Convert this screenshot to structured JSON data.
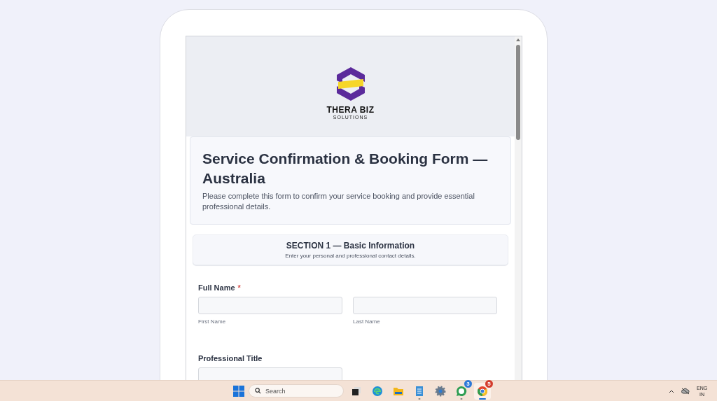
{
  "logo": {
    "name": "THERA BIZ",
    "tagline": "SOLUTIONS"
  },
  "form": {
    "title": "Service Confirmation & Booking Form — Australia",
    "description": "Please complete this form to confirm your service booking and provide essential professional details."
  },
  "section": {
    "title": "SECTION 1 — Basic Information",
    "subtitle": "Enter your personal and professional contact details."
  },
  "required_marker": "*",
  "fields": [
    {
      "kind": "name",
      "label": "Full Name",
      "required": true,
      "sublabels": [
        "First Name",
        "Last Name"
      ]
    },
    {
      "kind": "text",
      "label": "Professional Title",
      "required": false
    }
  ],
  "taskbar": {
    "search_placeholder": "Search",
    "apps": [
      {
        "kind": "taskview",
        "running": false,
        "selected": false
      },
      {
        "kind": "browser",
        "running": false,
        "selected": false
      },
      {
        "kind": "folder",
        "running": false,
        "selected": false
      },
      {
        "kind": "notepad",
        "running": true,
        "selected": false
      },
      {
        "kind": "settings",
        "running": false,
        "selected": false
      },
      {
        "kind": "chat",
        "running": true,
        "selected": false,
        "badge": "3"
      },
      {
        "kind": "chrome",
        "running": true,
        "selected": true,
        "badge": "5"
      }
    ],
    "language": [
      "ENG",
      "IN"
    ]
  }
}
